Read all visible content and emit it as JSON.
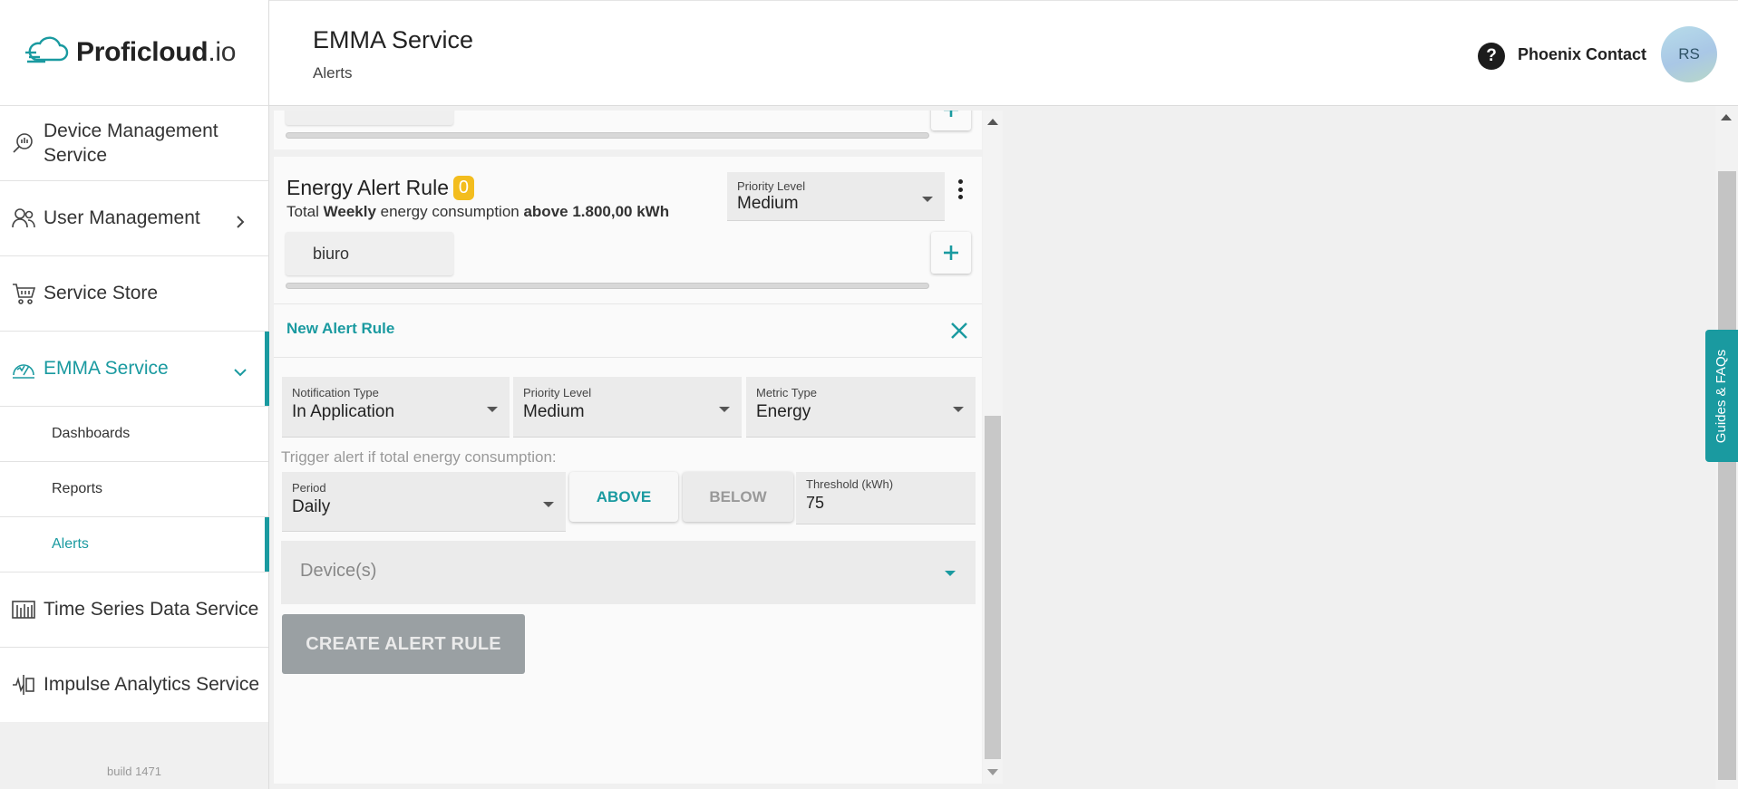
{
  "brand": {
    "name_bold": "Proficloud",
    "name_suffix": ".io"
  },
  "sidebar": {
    "items": [
      {
        "label": "Device Management Service",
        "icon": "device-search-icon"
      },
      {
        "label": "User Management",
        "icon": "users-icon"
      },
      {
        "label": "Service Store",
        "icon": "cart-icon"
      },
      {
        "label": "EMMA Service",
        "icon": "gauge-icon"
      },
      {
        "label": "Time Series Data Service",
        "icon": "chart-bars-icon"
      },
      {
        "label": "Impulse Analytics Service",
        "icon": "analytics-icon"
      }
    ],
    "sub_items": [
      "Dashboards",
      "Reports",
      "Alerts"
    ],
    "build": "build 1471"
  },
  "header": {
    "title": "EMMA Service",
    "subtitle": "Alerts",
    "help_glyph": "?",
    "org": "Phoenix Contact",
    "avatar_initials": "RS"
  },
  "rule": {
    "title": "Energy Alert Rule",
    "badge": "0",
    "desc_prefix": "Total ",
    "desc_period": "Weekly",
    "desc_mid": " energy consumption ",
    "desc_threshold": "above 1.800,00 kWh",
    "priority_label": "Priority Level",
    "priority_value": "Medium",
    "device_chip": "biuro"
  },
  "new_rule": {
    "title": "New Alert Rule",
    "notification_type": {
      "label": "Notification Type",
      "value": "In Application"
    },
    "priority": {
      "label": "Priority Level",
      "value": "Medium"
    },
    "metric": {
      "label": "Metric Type",
      "value": "Energy"
    },
    "trigger_label": "Trigger alert if total energy consumption:",
    "period": {
      "label": "Period",
      "value": "Daily"
    },
    "above_label": "ABOVE",
    "below_label": "BELOW",
    "threshold": {
      "label": "Threshold (kWh)",
      "value": "75"
    },
    "devices_placeholder": "Device(s)",
    "create_label": "CREATE ALERT RULE"
  },
  "guides_tab": "Guides & FAQs",
  "colors": {
    "accent": "#1a9aa0",
    "badge": "#f3bd1e",
    "disabled_button": "#9aa0a3"
  }
}
